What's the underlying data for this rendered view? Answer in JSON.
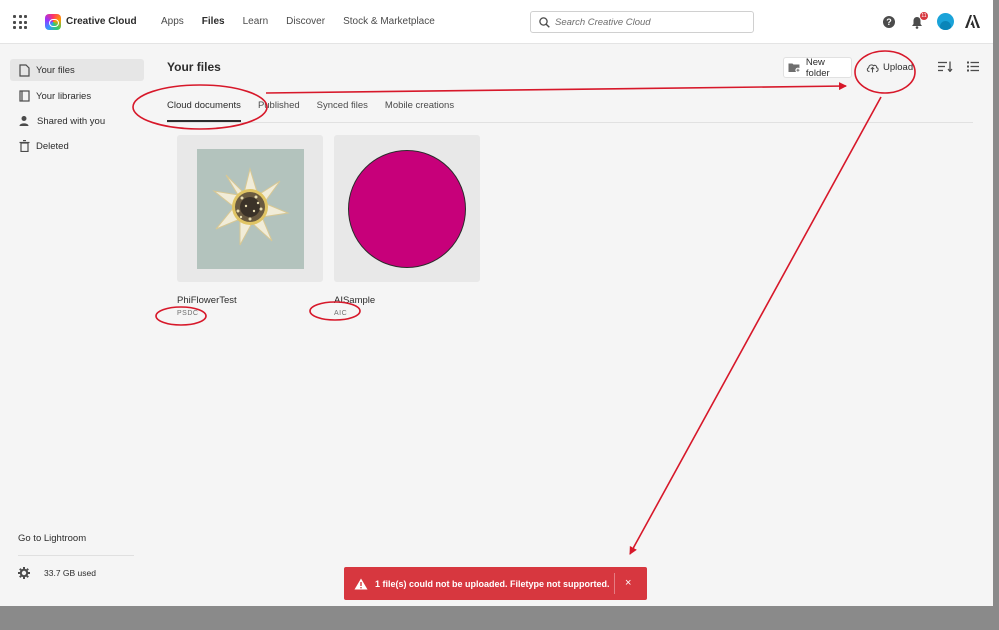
{
  "app": {
    "name": "Creative Cloud"
  },
  "nav": [
    "Apps",
    "Files",
    "Learn",
    "Discover",
    "Stock & Marketplace"
  ],
  "search": {
    "placeholder": "Search Creative Cloud"
  },
  "header": {
    "help_label": "?",
    "notification_count": "11"
  },
  "sidebar": {
    "items": [
      {
        "label": "Your files",
        "icon": "file-icon"
      },
      {
        "label": "Your libraries",
        "icon": "libraries-icon"
      },
      {
        "label": "Shared with you",
        "icon": "shared-icon"
      },
      {
        "label": "Deleted",
        "icon": "trash-icon"
      }
    ],
    "lightroom": "Go to Lightroom",
    "storage": "33.7 GB used"
  },
  "main": {
    "title": "Your files",
    "new_folder": "New folder",
    "upload": "Upload",
    "tabs": [
      "Cloud documents",
      "Published",
      "Synced files",
      "Mobile creations"
    ]
  },
  "files": [
    {
      "name": "PhiFlowerTest",
      "type": "PSDC"
    },
    {
      "name": "AISample",
      "type": "AIC"
    }
  ],
  "toast": {
    "message": "1 file(s) could not be uploaded. Filetype not supported.",
    "close": "×"
  },
  "colors": {
    "annotation": "#d7182a",
    "toast": "#d7373f",
    "pink": "#c7007a"
  }
}
